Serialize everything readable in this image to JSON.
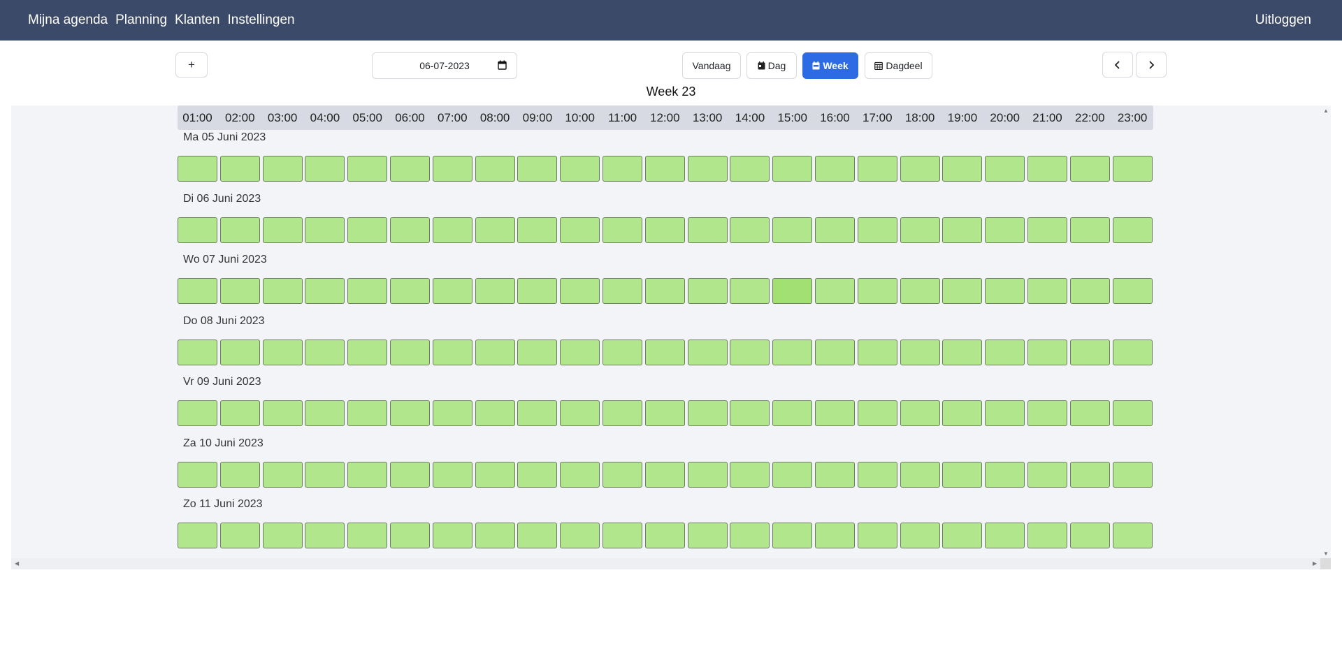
{
  "nav": {
    "items": [
      "Mijna agenda",
      "Planning",
      "Klanten",
      "Instellingen"
    ],
    "logout": "Uitloggen"
  },
  "toolbar": {
    "add_label": "+",
    "date_value": "06-07-2023",
    "today_label": "Vandaag",
    "day_label": "Dag",
    "week_label": "Week",
    "daypart_label": "Dagdeel",
    "prev_icon": "chevron-left-icon",
    "next_icon": "chevron-right-icon"
  },
  "week_title": "Week 23",
  "hours": [
    "01:00",
    "02:00",
    "03:00",
    "04:00",
    "05:00",
    "06:00",
    "07:00",
    "08:00",
    "09:00",
    "10:00",
    "11:00",
    "12:00",
    "13:00",
    "14:00",
    "15:00",
    "16:00",
    "17:00",
    "18:00",
    "19:00",
    "20:00",
    "21:00",
    "22:00",
    "23:00"
  ],
  "days": [
    "Ma 05 Juni 2023",
    "Di 06 Juni 2023",
    "Wo 07 Juni 2023",
    "Do 08 Juni 2023",
    "Vr 09 Juni 2023",
    "Za 10 Juni 2023",
    "Zo 11 Juni 2023"
  ],
  "colors": {
    "navbar": "#3b4a69",
    "slot_available": "#b2e68c",
    "slot_hover": "#a2e073",
    "active_button": "#2d6be4"
  },
  "highlighted_slot": {
    "day": "Wo 07 Juni 2023",
    "hour": "15:00"
  }
}
